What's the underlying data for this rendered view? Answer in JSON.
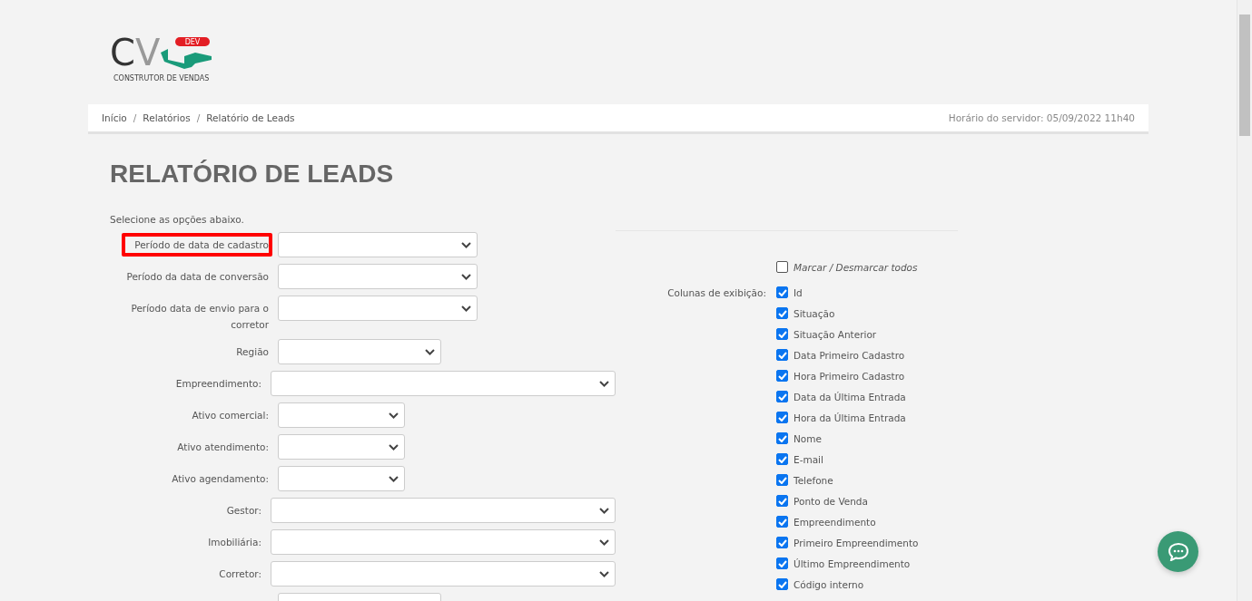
{
  "logo": {
    "mark_c": "C",
    "mark_v": "V",
    "badge": "DEV",
    "tagline": "CONSTRUTOR DE VENDAS"
  },
  "breadcrumb": [
    {
      "kind": "link",
      "text": "Início"
    },
    {
      "kind": "separator",
      "text": "/"
    },
    {
      "kind": "link",
      "text": "Relatórios"
    },
    {
      "kind": "separator",
      "text": "/"
    },
    {
      "kind": "current",
      "text": "Relatório de Leads"
    }
  ],
  "server_time": "Horário do servidor: 05/09/2022 11h40",
  "title": "RELATÓRIO DE LEADS",
  "intro": "Selecione as opções abaixo.",
  "filters": [
    {
      "label": "Período de data de cadastro",
      "highlighted": true
    },
    {
      "label": "Período da data de conversão",
      "highlighted": false
    },
    {
      "label": "Período data de envio para o corretor",
      "highlighted": false
    },
    {
      "label": "Região",
      "highlighted": false
    },
    {
      "label": "Empreendimento:",
      "highlighted": false
    },
    {
      "label": "Ativo comercial:",
      "highlighted": false
    },
    {
      "label": "Ativo atendimento:",
      "highlighted": false
    },
    {
      "label": "Ativo agendamento:",
      "highlighted": false
    },
    {
      "label": "Gestor:",
      "highlighted": false
    },
    {
      "label": "Imobiliária:",
      "highlighted": false
    },
    {
      "label": "Corretor:",
      "highlighted": false
    },
    {
      "highlighted": false
    }
  ],
  "toggle_all": {
    "label": "Marcar / Desmarcar todos",
    "checked": false
  },
  "columns_label": "Colunas de exibição:",
  "columns": [
    {
      "label": "Id",
      "checked": true
    },
    {
      "label": "Situação",
      "checked": true
    },
    {
      "label": "Situação Anterior",
      "checked": true
    },
    {
      "label": "Data Primeiro Cadastro",
      "checked": true
    },
    {
      "label": "Hora Primeiro Cadastro",
      "checked": true
    },
    {
      "label": "Data da Última Entrada",
      "checked": true
    },
    {
      "label": "Hora da Última Entrada",
      "checked": true
    },
    {
      "label": "Nome",
      "checked": true
    },
    {
      "label": "E-mail",
      "checked": true
    },
    {
      "label": "Telefone",
      "checked": true
    },
    {
      "label": "Ponto de Venda",
      "checked": true
    },
    {
      "label": "Empreendimento",
      "checked": true
    },
    {
      "label": "Primeiro Empreendimento",
      "checked": true
    },
    {
      "label": "Último Empreendimento",
      "checked": true
    },
    {
      "label": "Código interno",
      "checked": true
    }
  ]
}
